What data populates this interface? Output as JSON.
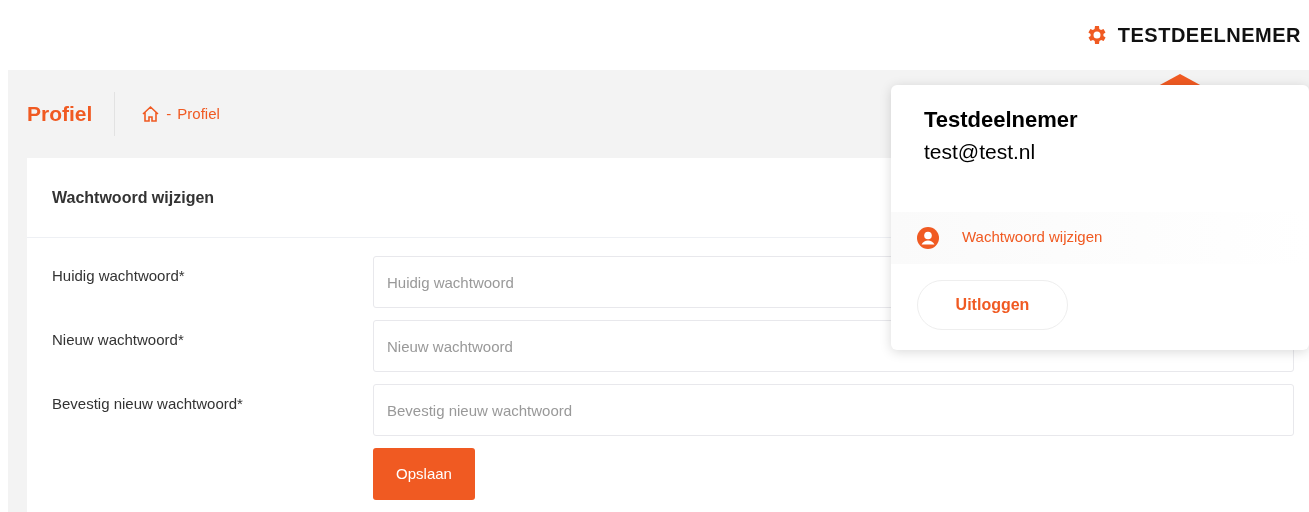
{
  "user_menu": {
    "label": "TESTDEELNEMER"
  },
  "page": {
    "title": "Profiel",
    "breadcrumb_separator": "-",
    "breadcrumb": "Profiel"
  },
  "card": {
    "title": "Wachtwoord wijzigen",
    "fields": [
      {
        "label": "Huidig wachtwoord*",
        "placeholder": "Huidig wachtwoord"
      },
      {
        "label": "Nieuw wachtwoord*",
        "placeholder": "Nieuw wachtwoord"
      },
      {
        "label": "Bevestig nieuw wachtwoord*",
        "placeholder": "Bevestig nieuw wachtwoord"
      }
    ],
    "button": "Opslaan"
  },
  "popover": {
    "name": "Testdeelnemer",
    "email": "test@test.nl",
    "items": [
      {
        "label": "Wachtwoord wijzigen"
      }
    ],
    "logout": "Uitloggen"
  }
}
